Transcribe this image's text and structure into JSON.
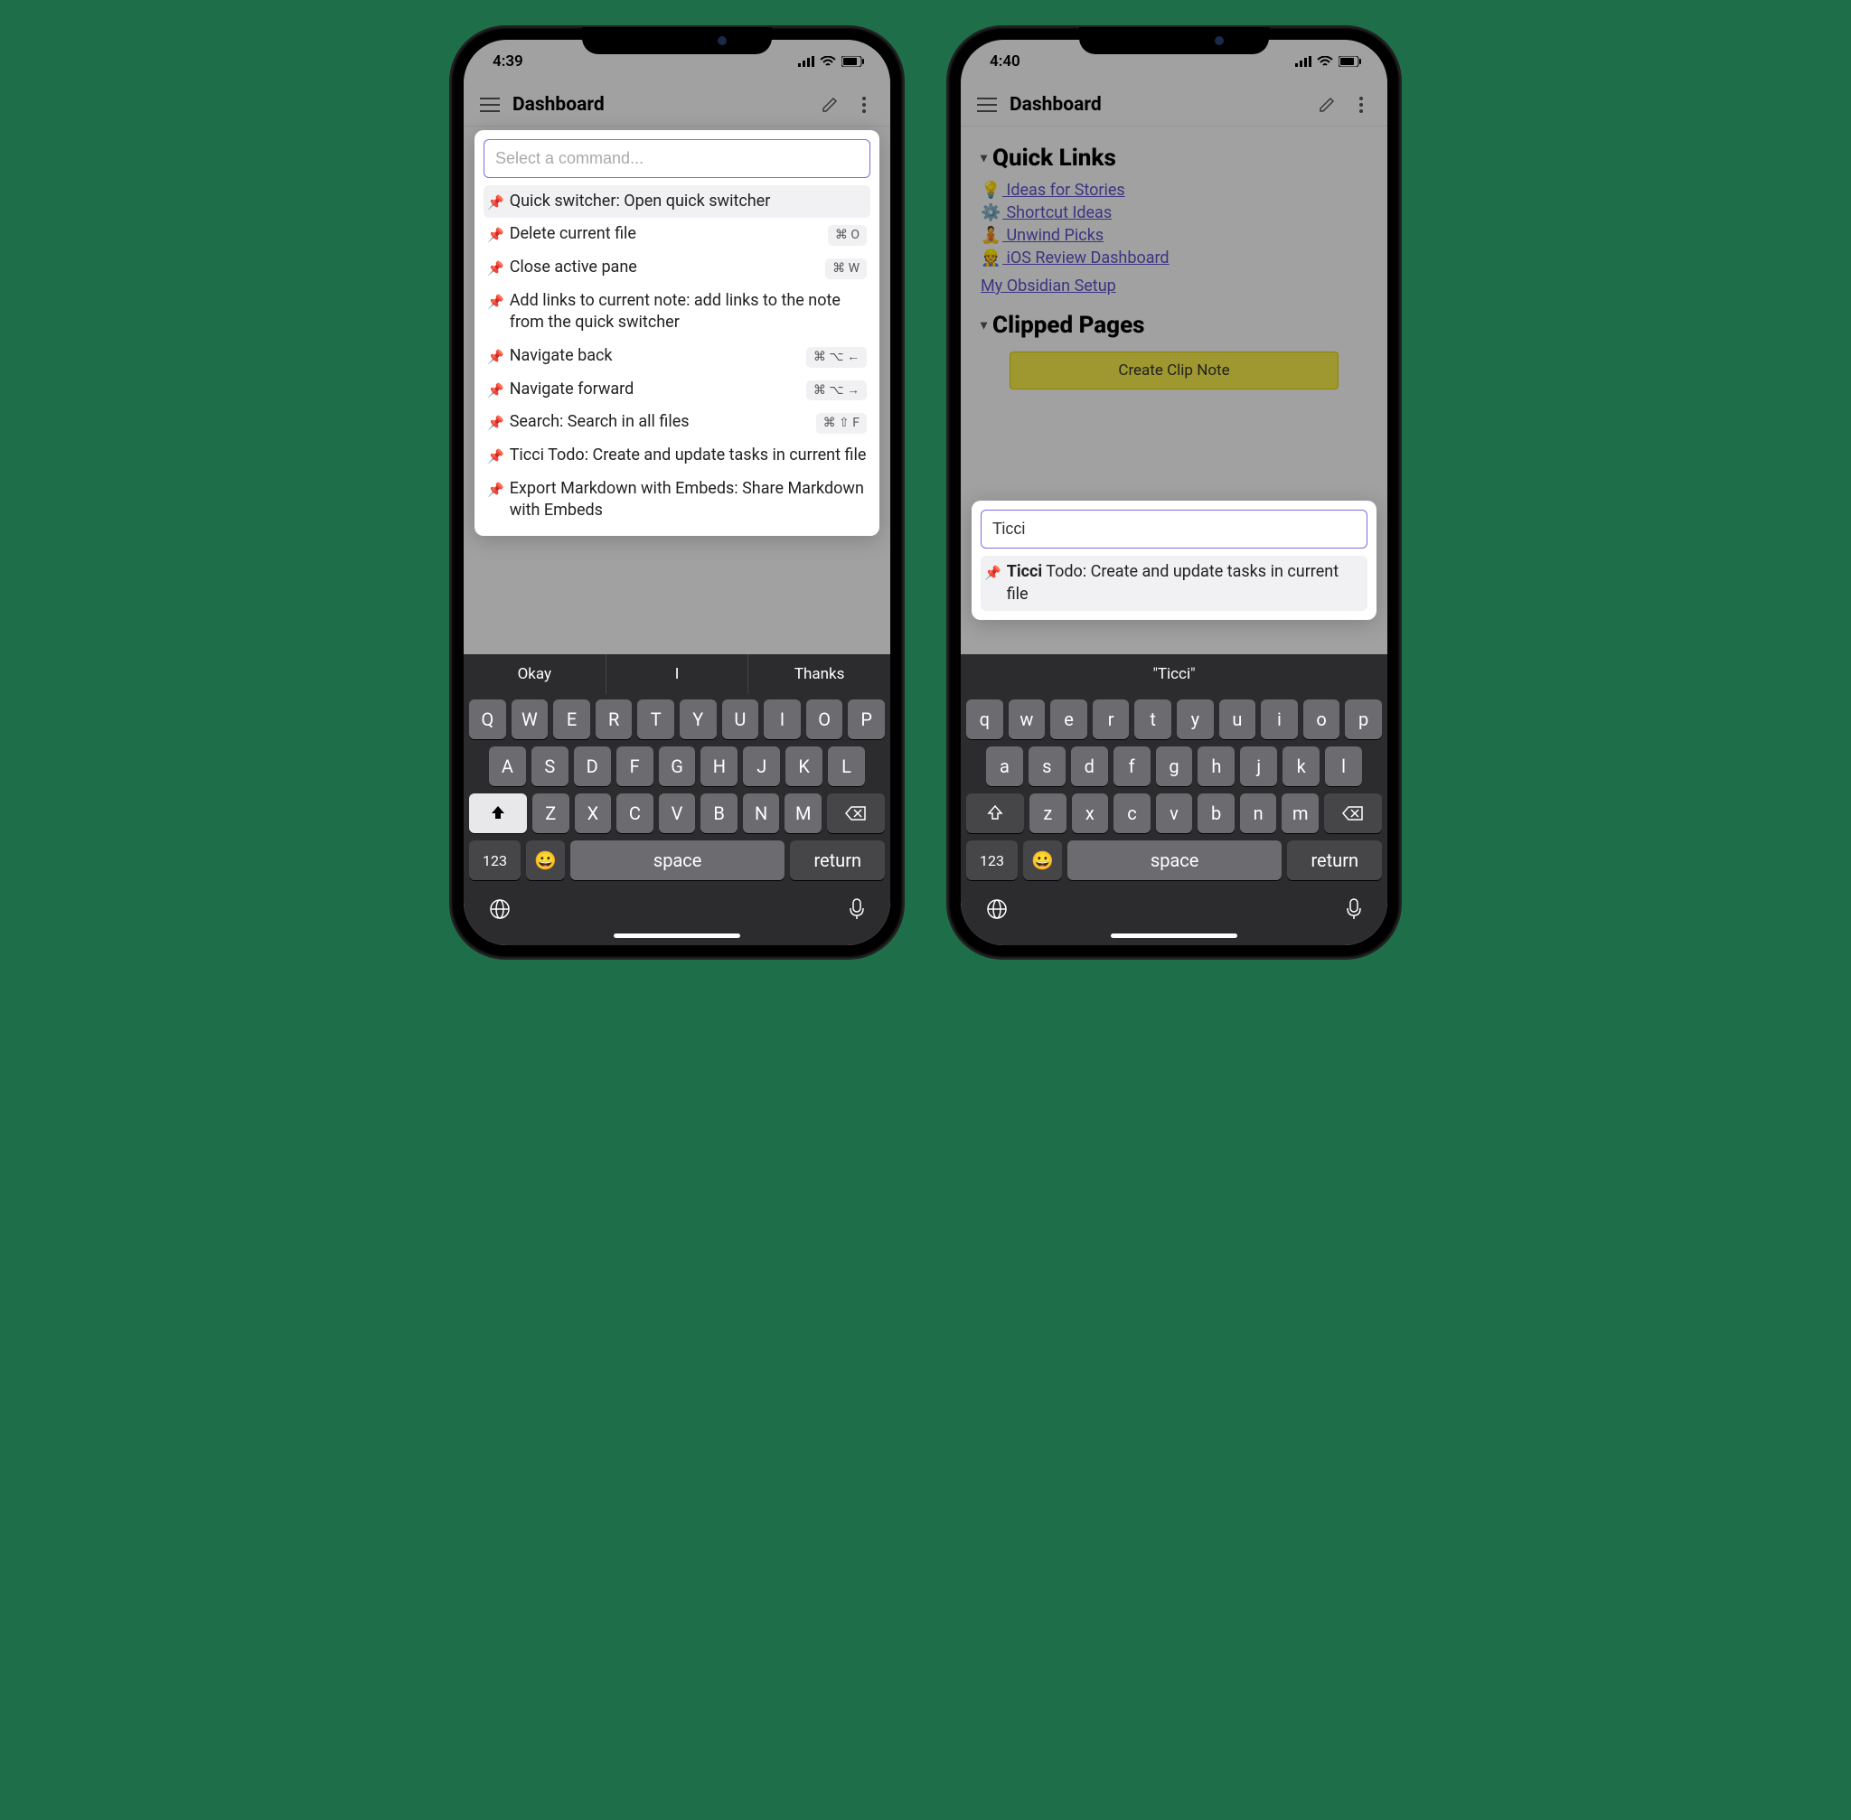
{
  "left": {
    "status": {
      "time": "4:39",
      "loc_arrow": "➤"
    },
    "topbar": {
      "title": "Dashboard"
    },
    "palette": {
      "placeholder": "Select a command...",
      "value": "",
      "items": [
        {
          "label": "Quick switcher: Open quick switcher",
          "shortcut": "",
          "selected": true
        },
        {
          "label": "Delete current file",
          "shortcut": "⌘ O"
        },
        {
          "label": "Close active pane",
          "shortcut": "⌘ W"
        },
        {
          "label": "Add links to current note: add links to the note from the quick switcher",
          "shortcut": ""
        },
        {
          "label": "Navigate back",
          "shortcut": "⌘ ⌥ ←"
        },
        {
          "label": "Navigate forward",
          "shortcut": "⌘ ⌥ →"
        },
        {
          "label": "Search: Search in all files",
          "shortcut": "⌘ ⇧ F"
        },
        {
          "label": "Ticci Todo: Create and update tasks in current file",
          "shortcut": ""
        },
        {
          "label": "Export Markdown with Embeds: Share Markdown with Embeds",
          "shortcut": ""
        }
      ]
    },
    "suggestions": [
      "Okay",
      "I",
      "Thanks"
    ],
    "keys": {
      "row1": [
        "Q",
        "W",
        "E",
        "R",
        "T",
        "Y",
        "U",
        "I",
        "O",
        "P"
      ],
      "row2": [
        "A",
        "S",
        "D",
        "F",
        "G",
        "H",
        "J",
        "K",
        "L"
      ],
      "row3": [
        "Z",
        "X",
        "C",
        "V",
        "B",
        "N",
        "M"
      ],
      "num": "123",
      "space": "space",
      "return": "return"
    }
  },
  "right": {
    "status": {
      "time": "4:40",
      "loc_arrow": "➤"
    },
    "topbar": {
      "title": "Dashboard"
    },
    "note": {
      "section1": "Quick Links",
      "links": [
        {
          "emoji": "💡",
          "text": "Ideas for Stories"
        },
        {
          "emoji": "⚙️",
          "text": "Shortcut Ideas"
        },
        {
          "emoji": "🧘",
          "text": "Unwind Picks"
        },
        {
          "emoji": "👷",
          "text": "iOS Review Dashboard"
        }
      ],
      "plainlink": "My Obsidian Setup",
      "section2": "Clipped Pages",
      "button": "Create Clip Note"
    },
    "palette": {
      "value": "Ticci",
      "result_pre": "Ticci",
      "result_post": " Todo: Create and update tasks in current file"
    },
    "suggestions": [
      "\"Ticci\""
    ],
    "keys": {
      "row1": [
        "q",
        "w",
        "e",
        "r",
        "t",
        "y",
        "u",
        "i",
        "o",
        "p"
      ],
      "row2": [
        "a",
        "s",
        "d",
        "f",
        "g",
        "h",
        "j",
        "k",
        "l"
      ],
      "row3": [
        "z",
        "x",
        "c",
        "v",
        "b",
        "n",
        "m"
      ],
      "num": "123",
      "space": "space",
      "return": "return"
    }
  }
}
